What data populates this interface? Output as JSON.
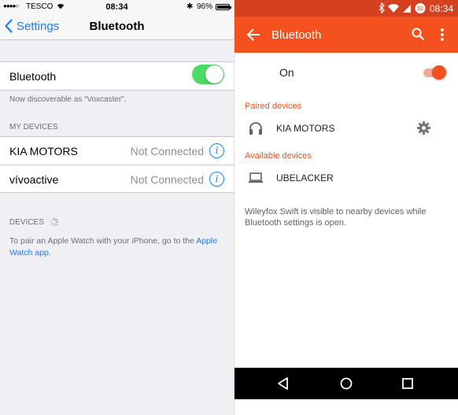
{
  "ios": {
    "status": {
      "carrier": "TESCO",
      "time": "08:34",
      "battery": "96%",
      "battery_level": 0.96
    },
    "nav": {
      "back_label": "Settings",
      "title": "Bluetooth"
    },
    "bluetooth_row": {
      "label": "Bluetooth",
      "toggle_on": true
    },
    "discoverable_note": "Now discoverable as “Voxcaster”.",
    "my_devices_header": "MY DEVICES",
    "my_devices": [
      {
        "name": "KIA MOTORS",
        "status": "Not Connected"
      },
      {
        "name": "vívoactive",
        "status": "Not Connected"
      }
    ],
    "devices_header": "DEVICES",
    "apple_watch_note": "To pair an Apple Watch with your iPhone, go to the ",
    "apple_watch_link": "Apple Watch app",
    "apple_watch_end": ".",
    "colors": {
      "accent": "#157efb",
      "toggle": "#4cd964"
    }
  },
  "android": {
    "status": {
      "time": "08:34",
      "battery": "92"
    },
    "toolbar": {
      "title": "Bluetooth"
    },
    "bluetooth_switch": {
      "label": "On",
      "on": true
    },
    "paired_header": "Paired devices",
    "paired_devices": [
      {
        "name": "KIA MOTORS",
        "icon": "headphones-icon"
      }
    ],
    "available_header": "Available devices",
    "available_devices": [
      {
        "name": "UBELACKER",
        "icon": "laptop-icon"
      }
    ],
    "visibility_note": "Wileyfox Swift is visible to nearby devices while Bluetooth settings is open.",
    "colors": {
      "accent": "#f4511e",
      "status_bar": "#d5411e"
    }
  }
}
